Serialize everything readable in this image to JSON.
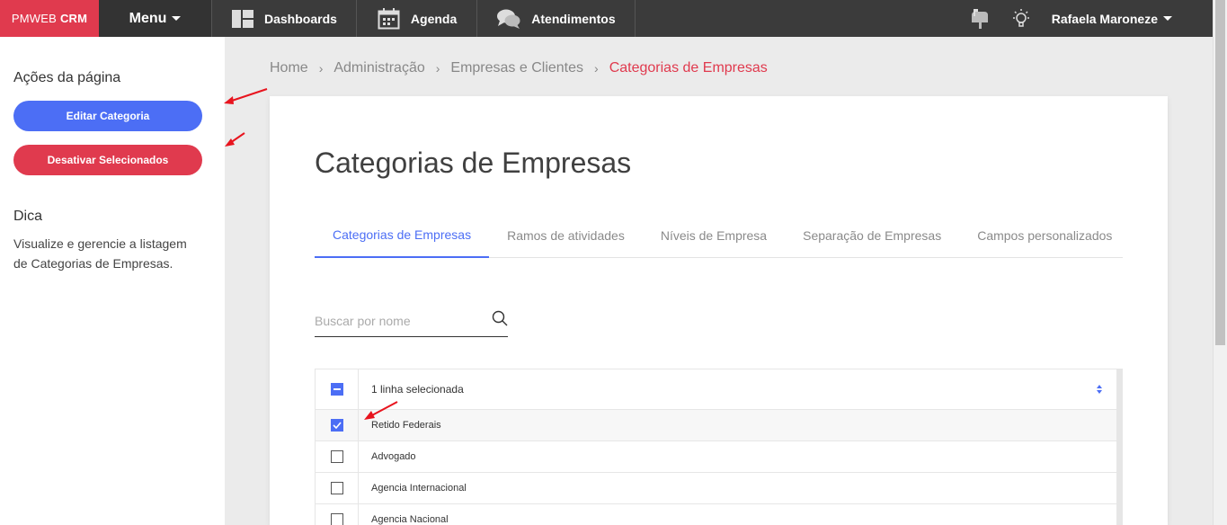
{
  "brand": {
    "name": "PMWEB",
    "product": "CRM",
    "color": "#e03a4e"
  },
  "topnav": {
    "menu_label": "Menu",
    "items": [
      {
        "label": "Dashboards",
        "icon": "dashboard-icon"
      },
      {
        "label": "Agenda",
        "icon": "calendar-icon"
      },
      {
        "label": "Atendimentos",
        "icon": "chat-icon"
      }
    ],
    "right_icons": [
      "mailbox-icon",
      "lightbulb-icon"
    ],
    "user_name": "Rafaela Maroneze"
  },
  "sidebar": {
    "actions_title": "Ações da página",
    "edit_button": "Editar Categoria",
    "deactivate_button": "Desativar Selecionados",
    "tip_title": "Dica",
    "tip_text": "Visualize e gerencie a listagem de Categorias de Empresas."
  },
  "breadcrumb": [
    "Home",
    "Administração",
    "Empresas e Clientes",
    "Categorias de Empresas"
  ],
  "page": {
    "title": "Categorias de Empresas",
    "tabs": [
      {
        "label": "Categorias de Empresas",
        "active": true
      },
      {
        "label": "Ramos de atividades",
        "active": false
      },
      {
        "label": "Níveis de Empresa",
        "active": false
      },
      {
        "label": "Separação de Empresas",
        "active": false
      },
      {
        "label": "Campos personalizados",
        "active": false
      }
    ],
    "search_placeholder": "Buscar por nome",
    "search_value": ""
  },
  "table": {
    "header_label": "1 linha selecionada",
    "rows": [
      {
        "name": "Retido Federais",
        "checked": true
      },
      {
        "name": "Advogado",
        "checked": false
      },
      {
        "name": "Agencia Internacional",
        "checked": false
      },
      {
        "name": "Agencia Nacional",
        "checked": false
      }
    ]
  },
  "colors": {
    "accent": "#4c6ef5",
    "danger": "#e03a4e",
    "topbar": "#3b3b3b"
  }
}
